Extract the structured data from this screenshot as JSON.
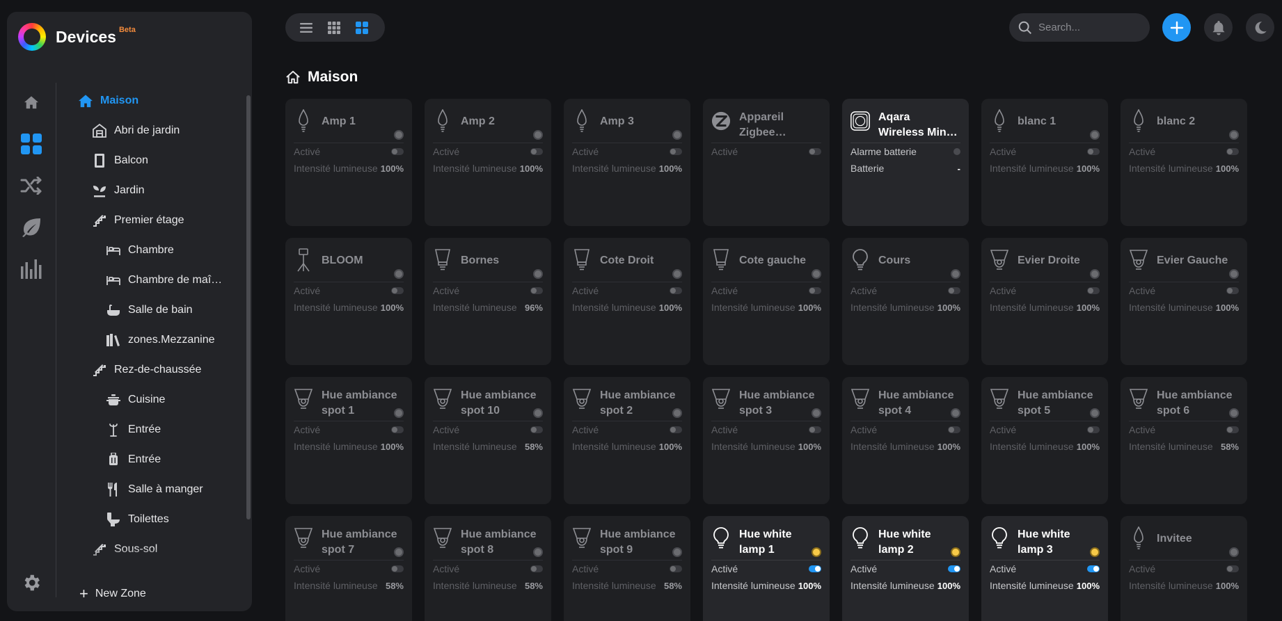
{
  "brand": {
    "title": "Devices",
    "badge": "Beta"
  },
  "rail": [
    {
      "name": "home",
      "icon": "home-icon",
      "active": false
    },
    {
      "name": "devices",
      "icon": "grid-icon",
      "active": true
    },
    {
      "name": "flows",
      "icon": "shuffle-icon",
      "active": false
    },
    {
      "name": "energy",
      "icon": "leaf-icon",
      "active": false
    },
    {
      "name": "insights",
      "icon": "chart-icon",
      "active": false
    }
  ],
  "tree": [
    {
      "label": "Maison",
      "level": 0,
      "icon": "home-icon",
      "active": true
    },
    {
      "label": "Abri de jardin",
      "level": 1,
      "icon": "shed-icon"
    },
    {
      "label": "Balcon",
      "level": 1,
      "icon": "door-icon"
    },
    {
      "label": "Jardin",
      "level": 1,
      "icon": "plant-icon"
    },
    {
      "label": "Premier étage",
      "level": 1,
      "icon": "stairs-icon"
    },
    {
      "label": "Chambre",
      "level": 2,
      "icon": "bed-icon"
    },
    {
      "label": "Chambre de maî…",
      "level": 2,
      "icon": "bed-icon"
    },
    {
      "label": "Salle de bain",
      "level": 2,
      "icon": "bath-icon"
    },
    {
      "label": "zones.Mezzanine",
      "level": 2,
      "icon": "books-icon"
    },
    {
      "label": "Rez-de-chaussée",
      "level": 1,
      "icon": "stairs-icon"
    },
    {
      "label": "Cuisine",
      "level": 2,
      "icon": "pot-icon"
    },
    {
      "label": "Entrée",
      "level": 2,
      "icon": "coat-rack-icon"
    },
    {
      "label": "Entrée",
      "level": 2,
      "icon": "luggage-icon"
    },
    {
      "label": "Salle à manger",
      "level": 2,
      "icon": "cutlery-icon"
    },
    {
      "label": "Toilettes",
      "level": 2,
      "icon": "toilet-icon"
    },
    {
      "label": "Sous-sol",
      "level": 1,
      "icon": "stairs-icon"
    }
  ],
  "new_zone": "New Zone",
  "search": {
    "placeholder": "Search..."
  },
  "page_title": "Maison",
  "colors": {
    "accent": "#2196f3",
    "badge": "#f28b3c",
    "light_on": "#f7c948"
  },
  "labels": {
    "active": "Activé",
    "intensity": "Intensité lumineuse",
    "battery_alarm": "Alarme batterie",
    "battery": "Batterie"
  },
  "devices": [
    {
      "name": "Amp 1",
      "icon": "bulb-candle-icon",
      "on": false,
      "intensity": "100%"
    },
    {
      "name": "Amp 2",
      "icon": "bulb-candle-icon",
      "on": false,
      "intensity": "100%"
    },
    {
      "name": "Amp 3",
      "icon": "bulb-candle-icon",
      "on": false,
      "intensity": "100%"
    },
    {
      "name": "Appareil Zigbee inconnu",
      "icon": "zigbee-icon",
      "on": false,
      "type": "zigbee"
    },
    {
      "name": "Aqara Wireless Mini Switch…",
      "icon": "switch-icon",
      "type": "switch",
      "battery": "-"
    },
    {
      "name": "blanc 1",
      "icon": "bulb-candle-icon",
      "on": false,
      "intensity": "100%"
    },
    {
      "name": "blanc 2",
      "icon": "bulb-candle-icon",
      "on": false,
      "intensity": "100%"
    },
    {
      "name": "BLOOM",
      "icon": "floor-lamp-icon",
      "on": false,
      "intensity": "100%"
    },
    {
      "name": "Bornes",
      "icon": "bulb-spot-icon",
      "on": false,
      "intensity": "96%"
    },
    {
      "name": "Cote Droit",
      "icon": "bulb-spot-icon",
      "on": false,
      "intensity": "100%"
    },
    {
      "name": "Cote gauche",
      "icon": "bulb-spot-icon",
      "on": false,
      "intensity": "100%"
    },
    {
      "name": "Cours",
      "icon": "bulb-icon",
      "on": false,
      "intensity": "100%"
    },
    {
      "name": "Evier Droite",
      "icon": "spot-icon",
      "on": false,
      "intensity": "100%"
    },
    {
      "name": "Evier Gauche",
      "icon": "spot-icon",
      "on": false,
      "intensity": "100%"
    },
    {
      "name": "Hue ambiance spot 1",
      "icon": "spot-icon",
      "on": false,
      "intensity": "100%"
    },
    {
      "name": "Hue ambiance spot 10",
      "icon": "spot-icon",
      "on": false,
      "intensity": "58%"
    },
    {
      "name": "Hue ambiance spot 2",
      "icon": "spot-icon",
      "on": false,
      "intensity": "100%"
    },
    {
      "name": "Hue ambiance spot 3",
      "icon": "spot-icon",
      "on": false,
      "intensity": "100%"
    },
    {
      "name": "Hue ambiance spot 4",
      "icon": "spot-icon",
      "on": false,
      "intensity": "100%"
    },
    {
      "name": "Hue ambiance spot 5",
      "icon": "spot-icon",
      "on": false,
      "intensity": "100%"
    },
    {
      "name": "Hue ambiance spot 6",
      "icon": "spot-icon",
      "on": false,
      "intensity": "58%"
    },
    {
      "name": "Hue ambiance spot 7",
      "icon": "spot-icon",
      "on": false,
      "intensity": "58%"
    },
    {
      "name": "Hue ambiance spot 8",
      "icon": "spot-icon",
      "on": false,
      "intensity": "58%"
    },
    {
      "name": "Hue ambiance spot 9",
      "icon": "spot-icon",
      "on": false,
      "intensity": "58%"
    },
    {
      "name": "Hue white lamp 1",
      "icon": "bulb-icon",
      "on": true,
      "intensity": "100%"
    },
    {
      "name": "Hue white lamp 2",
      "icon": "bulb-icon",
      "on": true,
      "intensity": "100%"
    },
    {
      "name": "Hue white lamp 3",
      "icon": "bulb-icon",
      "on": true,
      "intensity": "100%"
    },
    {
      "name": "Invitee",
      "icon": "bulb-candle-icon",
      "on": false,
      "intensity": "100%"
    }
  ]
}
